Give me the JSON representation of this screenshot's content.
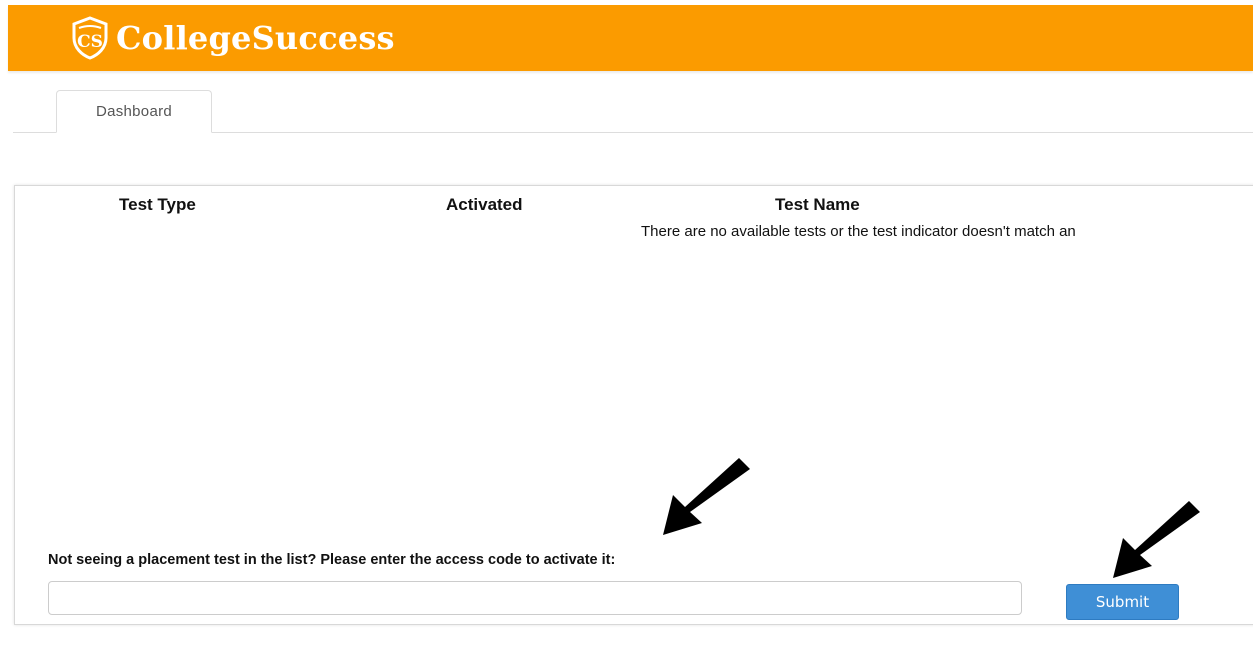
{
  "brand": {
    "name": "CollegeSuccess",
    "logo_initials": "CS",
    "color": "#fb9b00"
  },
  "tabs": [
    {
      "label": "Dashboard",
      "active": true
    }
  ],
  "table": {
    "columns": [
      "Test Type",
      "Activated",
      "Test Name"
    ],
    "empty_message": "There are no available tests or the test indicator doesn't match an"
  },
  "activation": {
    "label": "Not seeing a placement test in the list? Please enter the access code to activate it:",
    "input_value": "",
    "input_placeholder": "",
    "submit_label": "Submit",
    "submit_color": "#3f8fd6"
  },
  "annotations": {
    "arrow_color": "#000000"
  }
}
